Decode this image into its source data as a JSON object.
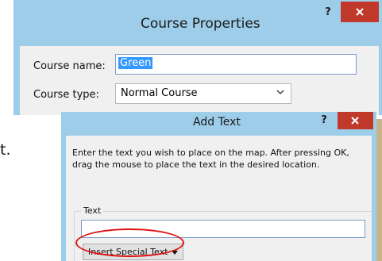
{
  "course_properties": {
    "title": "Course Properties",
    "help_label": "?",
    "name_label": "Course name:",
    "name_value": "Green",
    "type_label": "Course type:",
    "type_value": "Normal Course"
  },
  "stray_text": "t.",
  "add_text": {
    "title": "Add Text",
    "help_label": "?",
    "instructions": "Enter the text you wish to place on the map. After pressing OK, drag the mouse to place the text in the desired location.",
    "group_label": "Text",
    "text_value": "",
    "insert_special_label": "Insert Special Text"
  },
  "annotation": {
    "color": "#dd1111"
  },
  "colors": {
    "titlebar": "#9ecde9",
    "close": "#c0392b",
    "body": "#f0f0f0"
  }
}
